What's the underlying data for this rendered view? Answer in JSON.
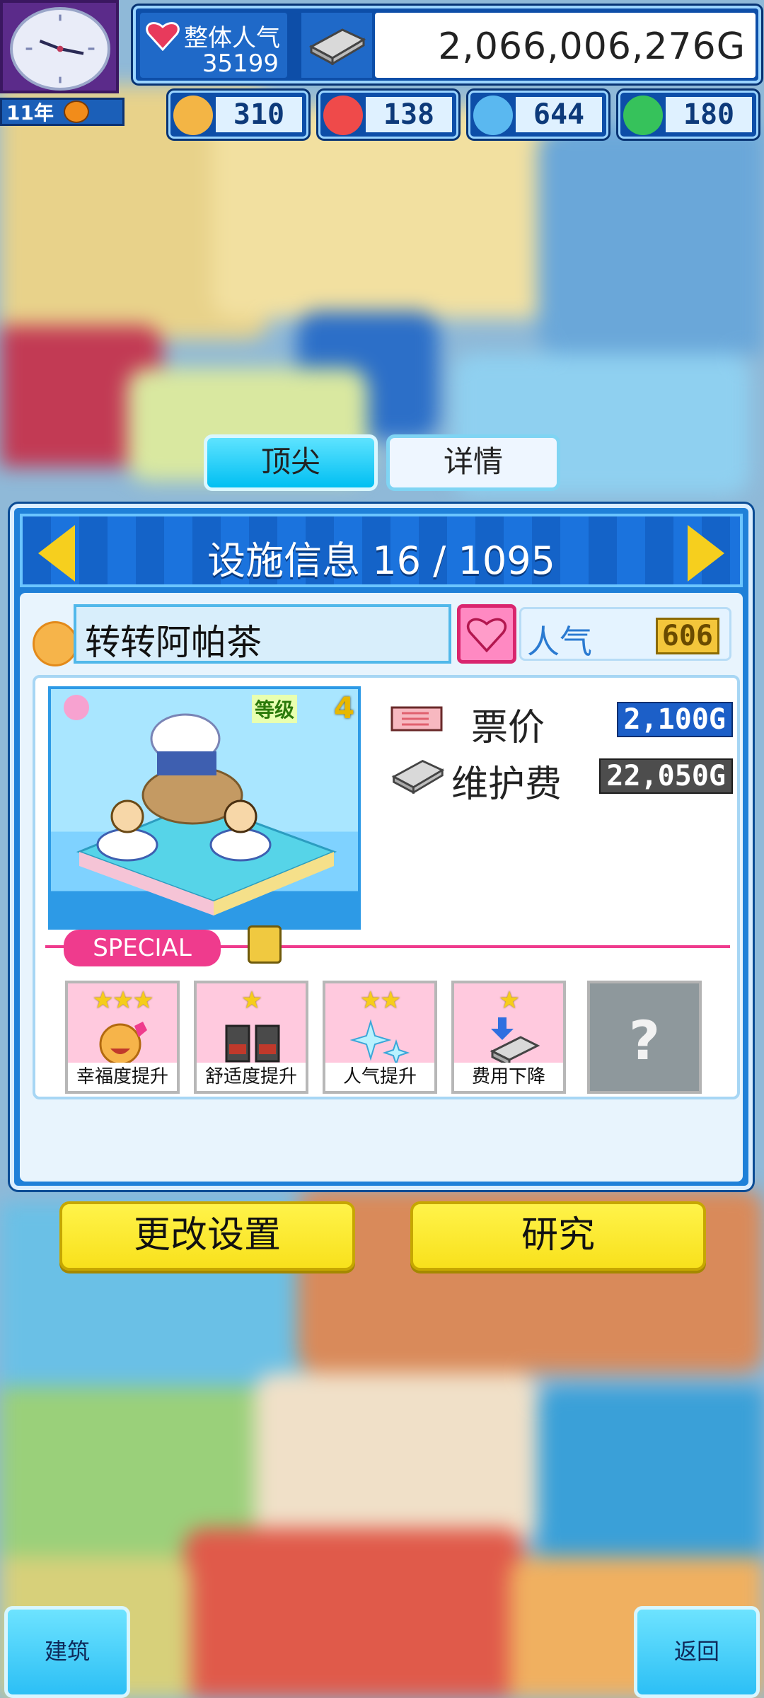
{
  "hud": {
    "year": "11年",
    "popularity_label": "整体人气",
    "popularity_value": "35199",
    "money": "2,066,006,276G",
    "stats": [
      {
        "icon": "smile-icon",
        "value": "310",
        "color": "#f3b545"
      },
      {
        "icon": "flame-icon",
        "value": "138",
        "color": "#ef4a4a"
      },
      {
        "icon": "water-drop-icon",
        "value": "644",
        "color": "#5ab8f0"
      },
      {
        "icon": "clover-icon",
        "value": "180",
        "color": "#36c25b"
      }
    ]
  },
  "tabs": [
    {
      "label": "顶尖",
      "active": true
    },
    {
      "label": "详情",
      "active": false
    }
  ],
  "panel": {
    "title": "设施信息 16 / 1095",
    "facility_name": "转转阿帕茶",
    "popularity_label": "人气",
    "popularity_value": "606",
    "level_label": "等级",
    "level_value": "4",
    "ticket_label": "票价",
    "ticket_value": "2,100G",
    "maintenance_label": "维护费",
    "maintenance_value": "22,050G",
    "special_label": "SPECIAL",
    "specials": [
      {
        "stars": "★★★",
        "caption": "幸福度提升",
        "icon": "happy-face-icon"
      },
      {
        "stars": "★",
        "caption": "舒适度提升",
        "icon": "seats-icon"
      },
      {
        "stars": "★★",
        "caption": "人气提升",
        "icon": "sparkle-icon"
      },
      {
        "stars": "★",
        "caption": "费用下降",
        "icon": "cost-down-icon"
      }
    ],
    "unknown_slot": "?",
    "change_settings": "更改设置",
    "research": "研究"
  },
  "bottom": {
    "build": "建筑",
    "back": "返回"
  }
}
